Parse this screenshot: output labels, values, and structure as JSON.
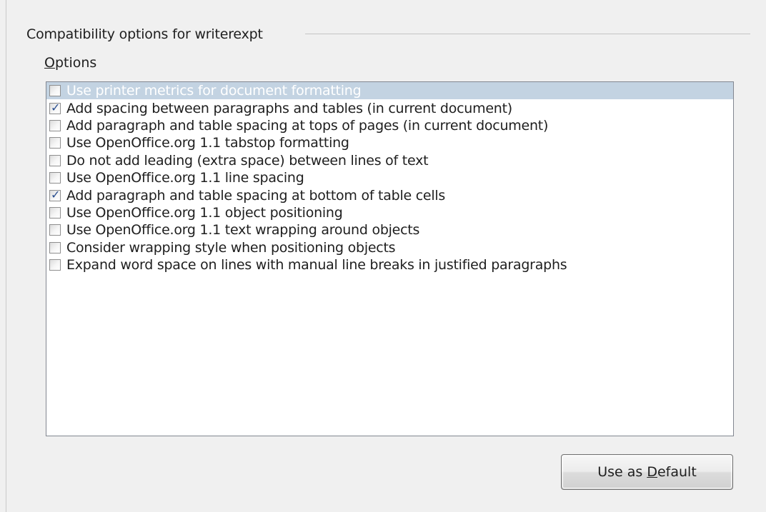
{
  "section": {
    "title": "Compatibility options for writerexpt"
  },
  "options_label": {
    "accel": "O",
    "rest": "ptions"
  },
  "options": [
    {
      "label": "Use printer metrics for document formatting",
      "checked": false,
      "selected": true
    },
    {
      "label": "Add spacing between paragraphs and tables (in current document)",
      "checked": true,
      "selected": false
    },
    {
      "label": "Add paragraph and table spacing at tops of pages (in current document)",
      "checked": false,
      "selected": false
    },
    {
      "label": "Use OpenOffice.org 1.1 tabstop formatting",
      "checked": false,
      "selected": false
    },
    {
      "label": "Do not add leading (extra space) between lines of text",
      "checked": false,
      "selected": false
    },
    {
      "label": "Use OpenOffice.org 1.1 line spacing",
      "checked": false,
      "selected": false
    },
    {
      "label": "Add paragraph and table spacing at bottom of table cells",
      "checked": true,
      "selected": false
    },
    {
      "label": "Use OpenOffice.org 1.1 object positioning",
      "checked": false,
      "selected": false
    },
    {
      "label": "Use OpenOffice.org 1.1 text wrapping around objects",
      "checked": false,
      "selected": false
    },
    {
      "label": "Consider wrapping style when positioning objects",
      "checked": false,
      "selected": false
    },
    {
      "label": "Expand word space on lines with manual line breaks in justified paragraphs",
      "checked": false,
      "selected": false
    }
  ],
  "button": {
    "prefix": "Use as ",
    "accel": "D",
    "rest": "efault"
  },
  "colors": {
    "selection": "#c3d3e2",
    "check": "#2b4f8f",
    "background": "#f0f0f0"
  },
  "icons": {
    "check": "check-icon"
  }
}
